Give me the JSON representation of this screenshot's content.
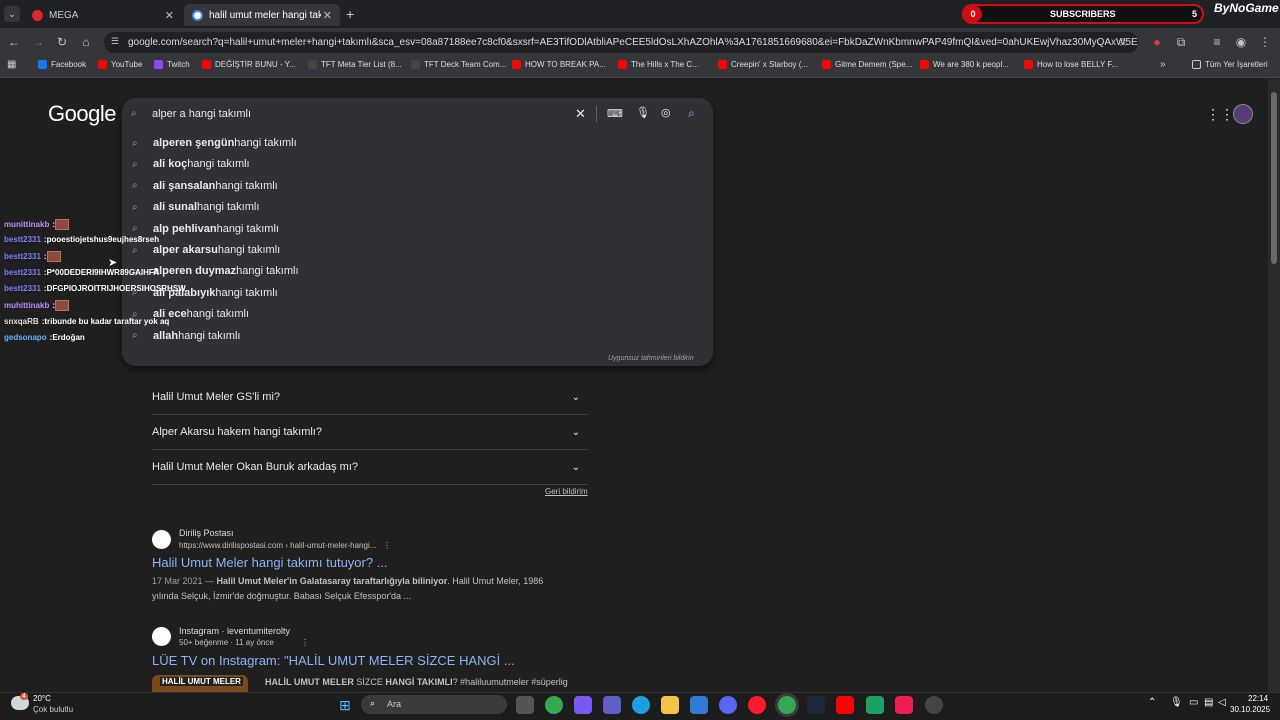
{
  "tabs": [
    {
      "label": "MEGA",
      "active": false
    },
    {
      "label": "halil umut meler hangi takımlı -",
      "active": true
    }
  ],
  "subscriber_widget": {
    "left_count": "0",
    "label": "SUBSCRIBERS",
    "right_count": "5",
    "brand": "ByNoGame"
  },
  "address_bar": {
    "url": "google.com/search?q=halil+umut+meler+hangi+takımlı&sca_esv=08a87188ee7c8cf0&sxsrf=AE3TifODlAtbliAPeCEE5ldOsLXhAZOhlA%3A1761851669680&ei=FbkDaZWnKbmnwPAP49fmQI&ved=0ahUKEwjVhaz30MyQAxW5ExAlHeOrOC..."
  },
  "bookmarks": [
    {
      "label": "Facebook",
      "color": "#1877f2"
    },
    {
      "label": "YouTube",
      "color": "#ff0000"
    },
    {
      "label": "Twitch",
      "color": "#9146ff"
    },
    {
      "label": "DEĞİŞTİR BUNU - Y...",
      "color": "#ff0000"
    },
    {
      "label": "TFT Meta Tier List (8...",
      "color": "#444"
    },
    {
      "label": "TFT Deck Team Com...",
      "color": "#444"
    },
    {
      "label": "HOW TO BREAK PA...",
      "color": "#ff0000"
    },
    {
      "label": "The Hills x The C...",
      "color": "#ff0000"
    },
    {
      "label": "Creepin' x Starboy (...",
      "color": "#ff0000"
    },
    {
      "label": "Gitme Demem (Spe...",
      "color": "#ff0000"
    },
    {
      "label": "We are 380 k peopl...",
      "color": "#ff0000"
    },
    {
      "label": "How to lose BELLY F...",
      "color": "#ff0000"
    }
  ],
  "all_bookmarks_label": "Tüm Yer İşaretleri",
  "google_logo": "Google",
  "search": {
    "query": "alper a hangi takımlı"
  },
  "suggestions": [
    {
      "bold": "alperen şengün",
      "rest": " hangi takımlı"
    },
    {
      "bold": "ali koç",
      "rest": " hangi takımlı"
    },
    {
      "bold": "ali şansalan",
      "rest": " hangi takımlı"
    },
    {
      "bold": "ali sunal",
      "rest": " hangi takımlı"
    },
    {
      "bold": "alp pehlivan",
      "rest": " hangi takımlı"
    },
    {
      "bold": "alper akarsu",
      "rest": " hangi takımlı"
    },
    {
      "bold": "alperen duymaz",
      "rest": " hangi takımlı"
    },
    {
      "bold": "ali palabıyık",
      "rest": " hangi takımlı"
    },
    {
      "bold": "ali ece",
      "rest": " hangi takımlı"
    },
    {
      "bold": "allah",
      "rest": " hangi takımlı"
    }
  ],
  "report_link": "Uygunsuz tahminleri bildirin",
  "faqs": [
    "Halil Umut Meler GS'li mi?",
    "Alper Akarsu hakem hangi takımlı?",
    "Halil Umut Meler Okan Buruk arkadaş mı?"
  ],
  "feedback_link": "Geri bildirim",
  "results": [
    {
      "site": "Diriliş Postası",
      "url": "https://www.dirilispostasi.com › halil-umut-meler-hangi...",
      "title": "Halil Umut Meler hangi takımı tutuyor? ...",
      "date": "17 Mar 2021 — ",
      "bold1": "Halil Umut Meler'in Galatasaray taraftarlığıyla biliniyor",
      "text1": ". Halil Umut Meler, 1986",
      "text2": "yılında Selçuk, İzmir'de doğmuştur. Babası Selçuk Efesspor'da ..."
    },
    {
      "site": "Instagram · leventumiterolty",
      "meta": "50+ beğenme · 11 ay önce",
      "title": "LÜE TV on Instagram: \"HALİL UMUT MELER SİZCE HANGİ ...",
      "thumb": "HALİL UMUT MELER",
      "snippet_b1": "HALİL UMUT MELER",
      "snippet_t1": " SİZCE ",
      "snippet_b2": "HANGİ TAKIMLI",
      "snippet_t2": "? #haliluumutmeler #süperlig"
    }
  ],
  "chat": [
    {
      "user": "munittinakb",
      "msg": "",
      "color": "#b98bff",
      "emote": true
    },
    {
      "user": "bestt2331",
      "msg": "pooestiojetshus9eujhes8rseh",
      "color": "#7d7dff"
    },
    {
      "user": "bestt2331",
      "msg": "",
      "color": "#7d7dff",
      "emote": true
    },
    {
      "user": "bestt2331",
      "msg": "P*00DEDERI9IHWR89GAIHFA",
      "color": "#7d7dff"
    },
    {
      "user": "bestt2331",
      "msg": "DFGPIOJROITRIJHOERSIHOSRHSW",
      "color": "#7d7dff"
    },
    {
      "user": "muhittinakb",
      "msg": "",
      "color": "#b98bff",
      "emote": true
    },
    {
      "user": "snxqaRB",
      "msg": "tribunde bu kadar taraftar yok aq",
      "color": "#dddddd"
    },
    {
      "user": "gedsonapo",
      "msg": "Erdoğan",
      "color": "#66b3ff"
    }
  ],
  "taskbar": {
    "weather_temp": "20°C",
    "weather_desc": "Çok bulutlu",
    "weather_badge": "4",
    "search_placeholder": "Ara",
    "time": "22:14",
    "date": "30.10.2025"
  }
}
